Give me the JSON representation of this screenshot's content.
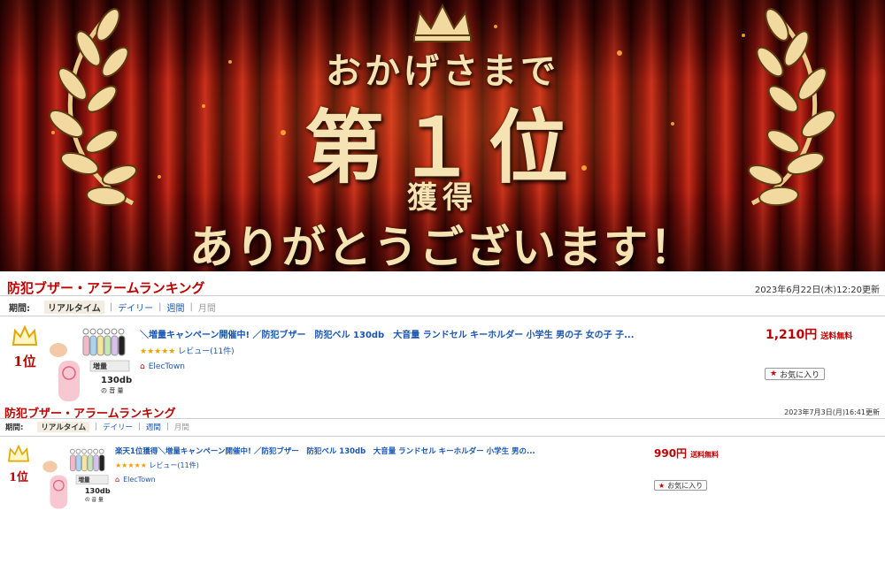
{
  "banner": {
    "line1": "おかげさまで",
    "line2": "第１位",
    "line3": "獲得",
    "line4": "ありがとうございます！"
  },
  "rankings": [
    {
      "title": "防犯ブザー・アラームランキング",
      "updated": "2023年6月22日(木)12:20更新",
      "period_label": "期間:",
      "tabs": [
        "リアルタイム",
        "デイリー",
        "週間",
        "月間"
      ],
      "rank": "1位",
      "product_title": "＼増量キャンペーン開催中! ／防犯ブザー　防犯ベル 130db　大音量 ランドセル キーホルダー 小学生 男の子 女の子 子...",
      "stars": "★★★★★",
      "review": "レビュー(11件)",
      "shop": "ElecTown",
      "price": "1,210円",
      "shipping": "送料無料",
      "favorite": "お気に入り",
      "thumb_badge": "増量",
      "thumb_db": "130db",
      "thumb_vol": "の 音 量"
    },
    {
      "title": "防犯ブザー・アラームランキング",
      "updated": "2023年7月3日(月)16:41更新",
      "period_label": "期間:",
      "tabs": [
        "リアルタイム",
        "デイリー",
        "週間",
        "月間"
      ],
      "rank": "1位",
      "product_title": "楽天1位獲得＼増量キャンペーン開催中! ／防犯ブザー　防犯ベル 130db　大音量 ランドセル キーホルダー 小学生 男の...",
      "stars": "★★★★★",
      "review": "レビュー(11件)",
      "shop": "ElecTown",
      "price": "990円",
      "shipping": "送料無料",
      "favorite": "お気に入り",
      "thumb_badge": "増量",
      "thumb_db": "130db",
      "thumb_vol": "の 音 量"
    }
  ],
  "colors": {
    "accent": "#bf0000",
    "link": "#1a56b0",
    "gold": "#f1d9a0",
    "star": "#f0a000"
  },
  "icons": [
    "crown-icon",
    "laurel-icon",
    "home-icon",
    "star-icon"
  ]
}
